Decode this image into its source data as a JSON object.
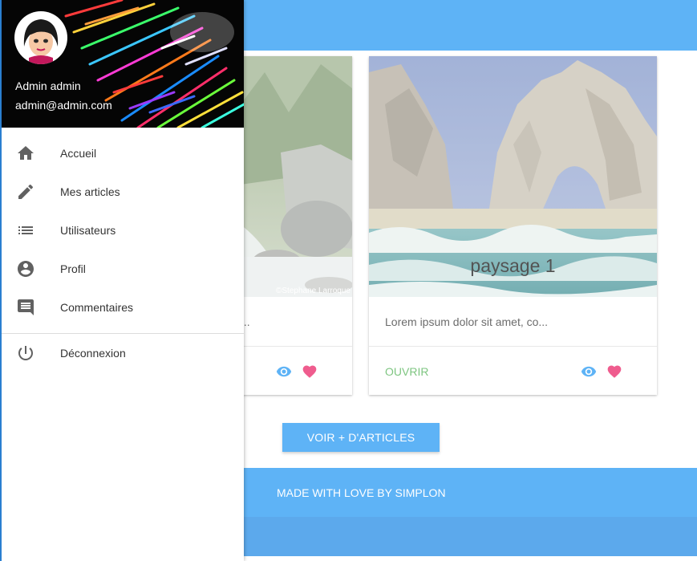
{
  "drawer": {
    "user_name": "Admin admin",
    "user_email": "admin@admin.com",
    "items": [
      {
        "label": "Accueil",
        "icon": "home-icon"
      },
      {
        "label": "Mes articles",
        "icon": "pencil-icon"
      },
      {
        "label": "Utilisateurs",
        "icon": "list-icon"
      },
      {
        "label": "Profil",
        "icon": "account-circle-icon"
      },
      {
        "label": "Commentaires",
        "icon": "comment-icon"
      },
      {
        "label": "Déconnexion",
        "icon": "power-icon"
      }
    ]
  },
  "cards": [
    {
      "image_watermark": "©Stephane Larroque",
      "text": "...",
      "icons": [
        "eye-icon",
        "heart-icon"
      ]
    },
    {
      "title": "paysage 1",
      "text": "Lorem ipsum dolor sit amet, co...",
      "open_label": "OUVRIR",
      "icons": [
        "eye-icon",
        "heart-icon"
      ]
    }
  ],
  "more_button": "VOIR + D'ARTICLES",
  "footer": {
    "text": "MADE WITH LOVE BY SIMPLON"
  },
  "colors": {
    "primary": "#2196f3",
    "open_link": "#4caf50",
    "eye_icon": "#2196f3",
    "heart_icon": "#e91e63"
  }
}
